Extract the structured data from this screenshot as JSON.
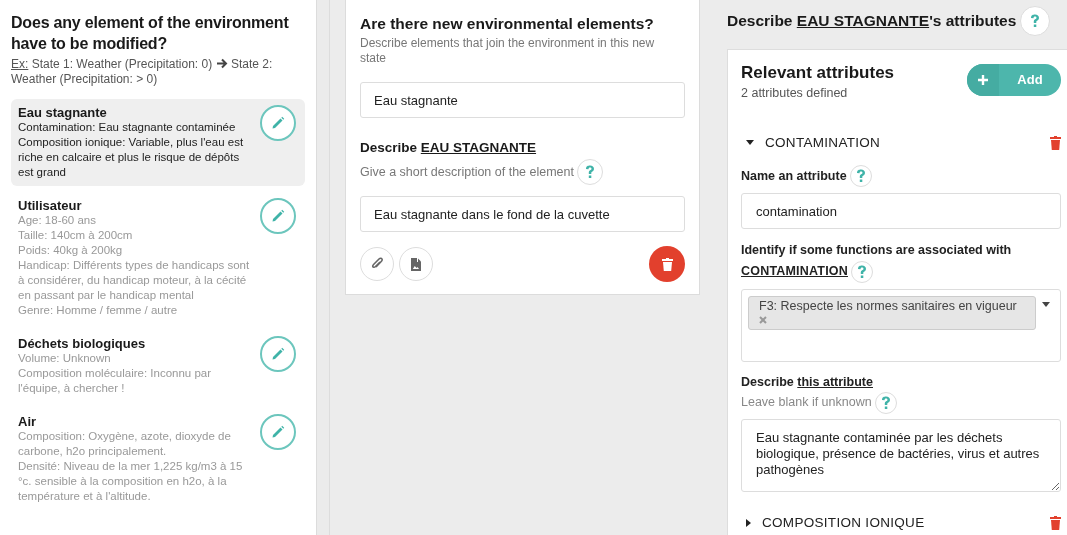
{
  "left": {
    "title": "Does any element of the environment have to be modified?",
    "example_label": "Ex:",
    "example_from": "State 1: Weather (Precipitation: 0)",
    "example_to": "State 2: Weather (Precipitation: > 0)",
    "elements": [
      {
        "name": "Eau stagnante",
        "selected": true,
        "details": [
          "Contamination: Eau stagnante contaminée",
          "Composition ionique: Variable, plus l'eau est riche en calcaire et plus le risque de dépôts est grand"
        ]
      },
      {
        "name": "Utilisateur",
        "selected": false,
        "details": [
          "Age: 18-60 ans",
          "Taille: 140cm à 200cm",
          "Poids: 40kg à 200kg",
          "Handicap: Différents types de handicaps sont à considérer, du handicap moteur, à la cécité en passant par le handicap mental",
          "Genre: Homme / femme / autre"
        ]
      },
      {
        "name": "Déchets biologiques",
        "selected": false,
        "details": [
          "Volume: Unknown",
          "Composition moléculaire: Inconnu par l'équipe, à chercher !"
        ]
      },
      {
        "name": "Air",
        "selected": false,
        "details": [
          "Composition: Oxygène, azote, dioxyde de carbone, h2o principalement.",
          "Densité: Niveau de la mer 1,225 kg/m3 à 15 °c. sensible à la composition en h2o, à la température et à l'altitude."
        ]
      }
    ]
  },
  "middle": {
    "title": "Are there new environmental elements?",
    "subtitle": "Describe elements that join the environment in this new state",
    "name_value": "Eau stagnante",
    "describe_label": "Describe",
    "describe_link": "EAU STAGNANTE",
    "hint": "Give a short description of the element",
    "description_value": "Eau stagnante dans le fond de la cuvette"
  },
  "right": {
    "heading_prefix": "Describe",
    "heading_link": "EAU STAGNANTE",
    "heading_suffix": "'s attributes",
    "card_title": "Relevant attributes",
    "count": "2 attributes defined",
    "add_button": "Add",
    "attributes": [
      {
        "name": "CONTAMINATION",
        "expanded": true,
        "name_label": "Name an attribute",
        "name_value": "contamination",
        "functions_label": "Identify if some functions are associated with",
        "functions_link": "CONTAMINATION",
        "tags": [
          "F3: Respecte les normes sanitaires en vigueur"
        ],
        "describe_label": "Describe",
        "describe_link": "this attribute",
        "hint": "Leave blank if unknown",
        "description": "Eau stagnante contaminée par les déchets biologique, présence de bactéries, virus et autres pathogènes"
      },
      {
        "name": "COMPOSITION IONIQUE",
        "expanded": false
      }
    ]
  }
}
